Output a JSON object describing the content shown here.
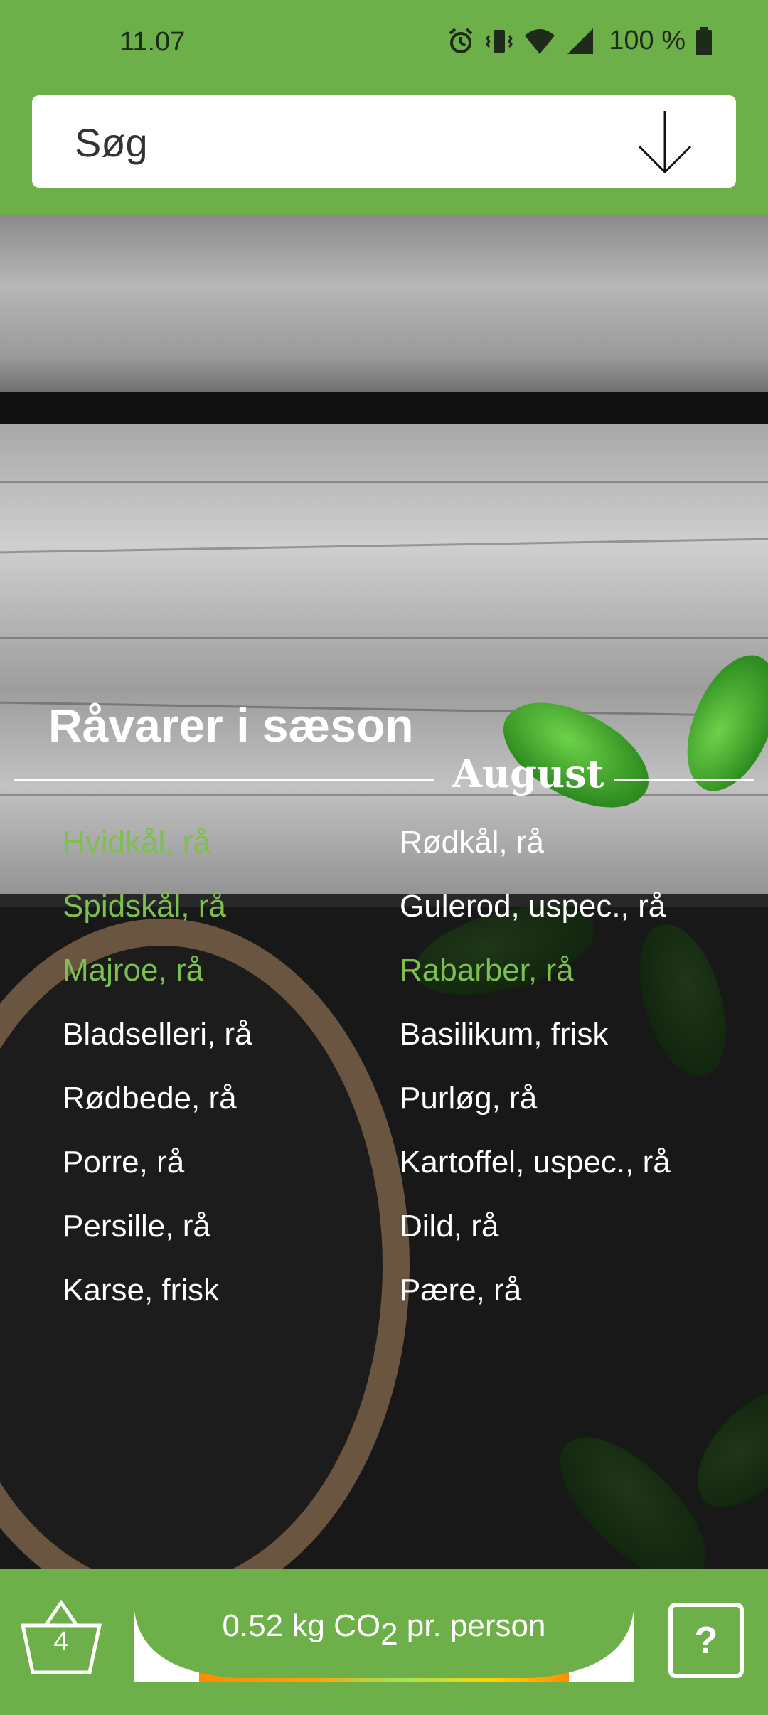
{
  "status_bar": {
    "time": "11.07",
    "icons": [
      "alarm-icon",
      "vibrate-icon",
      "wifi-icon",
      "signal-icon",
      "battery-icon"
    ],
    "battery": "100 %"
  },
  "search": {
    "placeholder": "Søg",
    "icon": "arrow-down-icon"
  },
  "season": {
    "title": "Råvarer i sæson",
    "month": "August",
    "items": [
      {
        "label": "Hvidkål, rå",
        "highlighted": true
      },
      {
        "label": "Rødkål, rå",
        "highlighted": false
      },
      {
        "label": "Spidskål, rå",
        "highlighted": true
      },
      {
        "label": "Gulerod, uspec., rå",
        "highlighted": false
      },
      {
        "label": "Majroe, rå",
        "highlighted": true
      },
      {
        "label": "Rabarber, rå",
        "highlighted": true
      },
      {
        "label": "Bladselleri, rå",
        "highlighted": false
      },
      {
        "label": "Basilikum, frisk",
        "highlighted": false
      },
      {
        "label": "Rødbede, rå",
        "highlighted": false
      },
      {
        "label": "Purløg, rå",
        "highlighted": false
      },
      {
        "label": "Porre, rå",
        "highlighted": false
      },
      {
        "label": "Kartoffel, uspec., rå",
        "highlighted": false
      },
      {
        "label": "Persille, rå",
        "highlighted": false
      },
      {
        "label": "Dild, rå",
        "highlighted": false
      },
      {
        "label": "Karse, frisk",
        "highlighted": false
      },
      {
        "label": "Pære, rå",
        "highlighted": false
      }
    ],
    "highlight_color": "#7dc04f"
  },
  "bottom_bar": {
    "basket_count": "4",
    "co2_value": "0.52",
    "co2_unit": "kg CO",
    "co2_sub": "2",
    "co2_suffix": "pr. person",
    "help_label": "?"
  },
  "colors": {
    "brand_green": "#6db04a",
    "meter_gradient": [
      "#ff8c00",
      "#ffd400",
      "#7ed957"
    ]
  }
}
